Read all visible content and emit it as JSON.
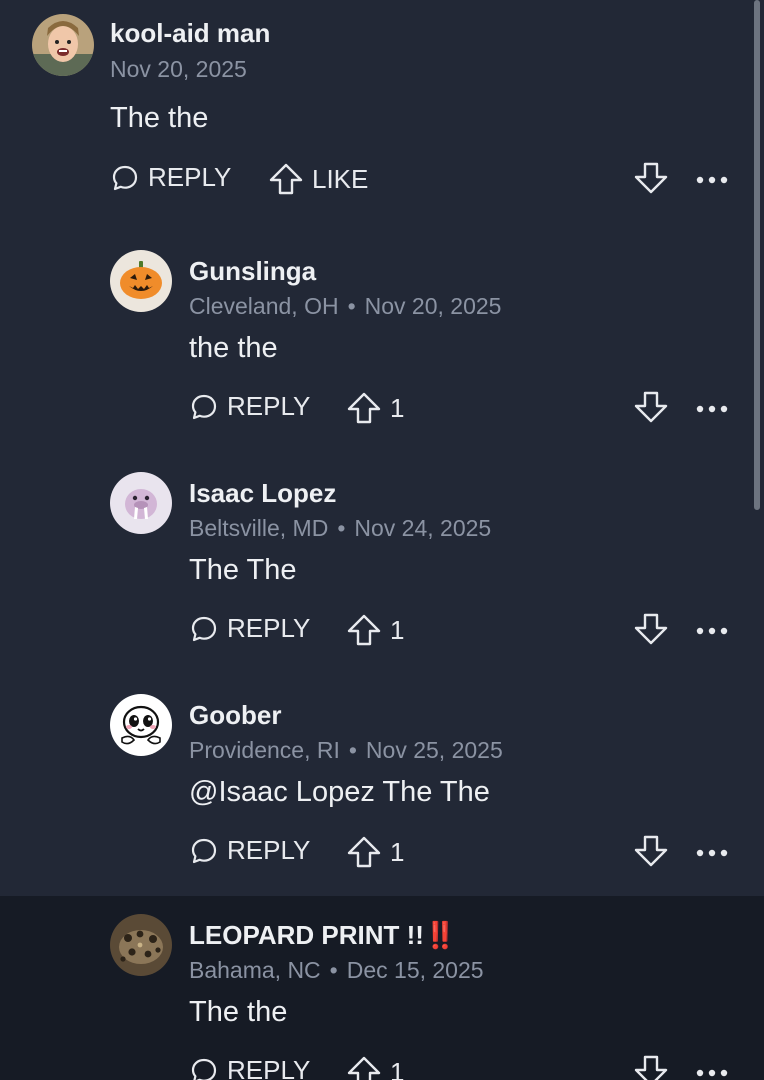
{
  "comments": [
    {
      "username": "kool-aid man",
      "location": "",
      "date": "Nov 20, 2025",
      "text": "The the",
      "reply_label": "REPLY",
      "like_label": "LIKE",
      "like_count": ""
    },
    {
      "username": "Gunslinga",
      "location": "Cleveland, OH",
      "date": "Nov 20, 2025",
      "text": "the the",
      "reply_label": "REPLY",
      "like_label": "",
      "like_count": "1"
    },
    {
      "username": "Isaac Lopez",
      "location": "Beltsville, MD",
      "date": "Nov 24, 2025",
      "text": "The The",
      "reply_label": "REPLY",
      "like_label": "",
      "like_count": "1"
    },
    {
      "username": "Goober",
      "location": "Providence, RI",
      "date": "Nov 25, 2025",
      "text": "@Isaac Lopez The The",
      "reply_label": "REPLY",
      "like_label": "",
      "like_count": "1"
    },
    {
      "username": "LEOPARD PRINT !!",
      "username_emoji": "‼️",
      "location": "Bahama, NC",
      "date": "Dec 15, 2025",
      "text": "The the",
      "reply_label": "REPLY",
      "like_label": "",
      "like_count": "1"
    }
  ],
  "meta_separator": "•",
  "colors": {
    "background": "#222836",
    "highlight_background": "#161b25",
    "text": "#eef0f3",
    "meta": "#8b93a3",
    "accent_red": "#e5312c"
  },
  "icons": {
    "reply": "speech-bubble-icon",
    "like": "upvote-arrow-icon",
    "downvote": "downvote-arrow-icon",
    "more": "more-dots-icon"
  }
}
